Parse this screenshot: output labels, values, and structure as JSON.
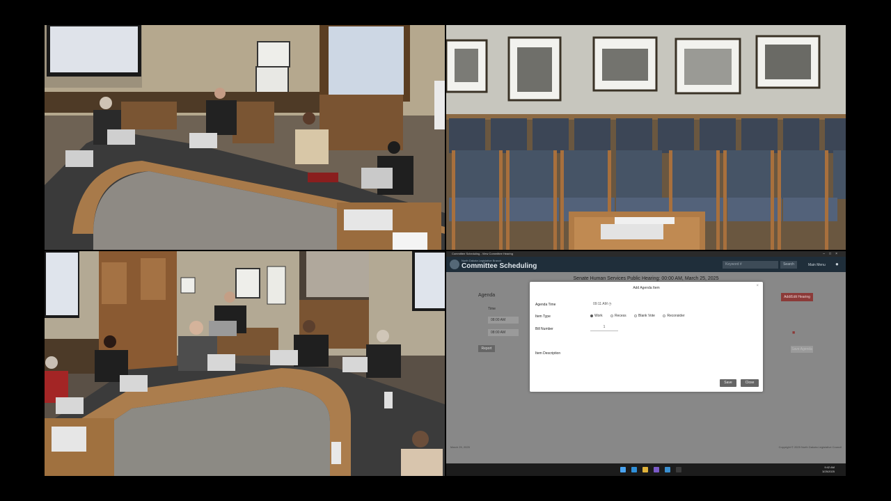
{
  "screen": {
    "window_title": "Committee Scheduling - View Committee Hearing",
    "app": {
      "subtitle": "North Dakota Legislative Branch",
      "title": "Committee Scheduling",
      "search_placeholder": "Keyword #",
      "search_button": "Search",
      "menu": "Main Menu"
    },
    "hearing_title": "Senate Human Services Public Hearing: 00:00 AM, March 25, 2025",
    "agenda_label": "Agenda",
    "time_column": "Time",
    "time_rows": [
      "08:00 AM",
      "08:00 AM"
    ],
    "report_button": "Report",
    "add_hearing_button": "Add/Edit Hearing",
    "save_agenda_button": "Save Agenda",
    "footer_date": "March 25, 2025",
    "footer_copyright": "Copyright © 2025 North Dakota Legislative Council",
    "modal": {
      "title": "Add Agenda Item",
      "agenda_time_label": "Agenda Time",
      "agenda_time_value": "09:11 AM",
      "item_type_label": "Item Type",
      "item_types": [
        "Work",
        "Recess",
        "Blank Vote",
        "Reconsider"
      ],
      "selected_type": "Work",
      "bill_number_label": "Bill Number",
      "bill_number_value": "1",
      "item_description_label": "Item Description",
      "save_button": "Save",
      "close_button": "Close"
    },
    "taskbar": {
      "time": "9:42 AM",
      "date": "3/25/2025"
    }
  },
  "colors": {
    "app_header": "#1f2e3a",
    "accent_red": "#8c3a38",
    "background_dim": "#888888"
  }
}
